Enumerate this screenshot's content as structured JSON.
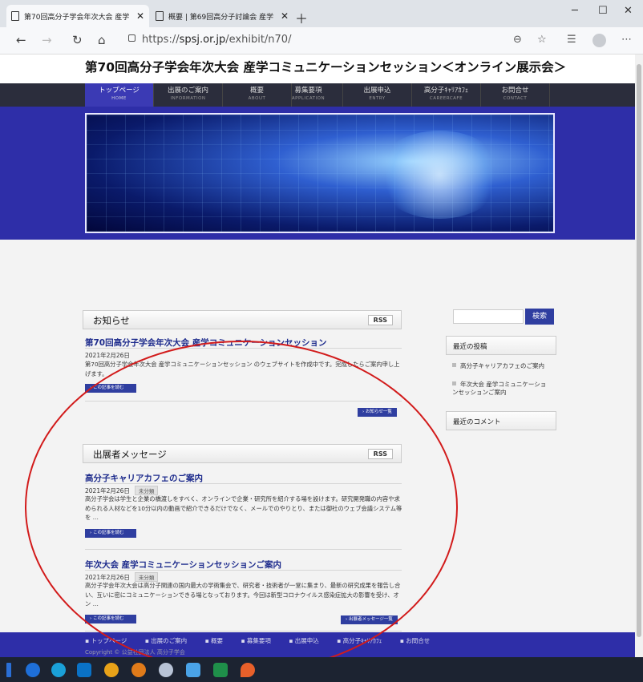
{
  "browser": {
    "tabs": [
      {
        "title": "第70回高分子学会年次大会 産学"
      },
      {
        "title": "概要 | 第69回高分子討論会 産学"
      }
    ],
    "url_scheme": "https://",
    "url_host": "spsj.or.jp",
    "url_path": "/exhibit/n70/"
  },
  "site": {
    "title": "第70回高分子学会年次大会 産学コミュニケーションセッション＜オンライン展示会＞",
    "nav": [
      {
        "jp": "トップページ",
        "en": "HOME"
      },
      {
        "jp": "出展のご案内",
        "en": "INFORMATION"
      },
      {
        "jp": "概要",
        "en": "ABOUT"
      },
      {
        "jp": "募集要項",
        "en": "APPLICATION"
      },
      {
        "jp": "出展申込",
        "en": "ENTRY"
      },
      {
        "jp": "高分子ｷｬﾘｱｶﾌｪ",
        "en": "CAREERCAFE"
      },
      {
        "jp": "お問合せ",
        "en": "CONTACT"
      }
    ]
  },
  "news": {
    "heading": "お知らせ",
    "rss": "RSS",
    "post": {
      "title": "第70回高分子学会年次大会 産学コミュニケーションセッション",
      "date": "2021年2月26日",
      "body": "第70回高分子学会年次大会 産学コミュニケーションセッション のウェブサイトを作成中です。完成したらご案内申し上げます。",
      "more": "› この記事を読む"
    },
    "list_link": "› お知らせ一覧"
  },
  "messages": {
    "heading": "出展者メッセージ",
    "rss": "RSS",
    "posts": [
      {
        "title": "高分子キャリアカフェのご案内",
        "date": "2021年2月26日",
        "category": "未分類",
        "body": "高分子学会は学生と企業の橋渡しをすべく、オンラインで企業・研究所を紹介する場を設けます。研究開発職の内容や求められる人材などを10分以内の動画で紹介できるだけでなく、メールでのやりとり、または御社のウェブ会議システム等を …",
        "more": "› この記事を読む"
      },
      {
        "title": "年次大会 産学コミュニケーションセッションご案内",
        "date": "2021年2月26日",
        "category": "未分類",
        "body": "高分子学会年次大会は高分子関連の国内最大の学術集会で、研究者・技術者が一堂に集まり、最新の研究成果を報告し合い、互いに密にコミュニケーションできる場となっております。今回は新型コロナウイルス感染症拡大の影響を受け、オン …",
        "more": "› この記事を読む"
      }
    ],
    "list_link": "› 出展者メッセージ一覧"
  },
  "sidebar": {
    "search_button": "検索",
    "recent_posts_heading": "最近の投稿",
    "recent_posts": [
      "高分子キャリアカフェのご案内",
      "年次大会 産学コミュニケーションセッションご案内"
    ],
    "recent_comments_heading": "最近のコメント"
  },
  "footer": {
    "links": [
      "トップページ",
      "出展のご案内",
      "概要",
      "募集要項",
      "出展申込",
      "高分子ｷｬﾘｱｶﾌｪ",
      "お問合せ"
    ],
    "copyright": "Copyright © 公益社団法人 高分子学会"
  },
  "colors": {
    "brand_blue": "#2e2ea8",
    "link_blue": "#1d2b8c",
    "annotation_red": "#d21b1b"
  }
}
